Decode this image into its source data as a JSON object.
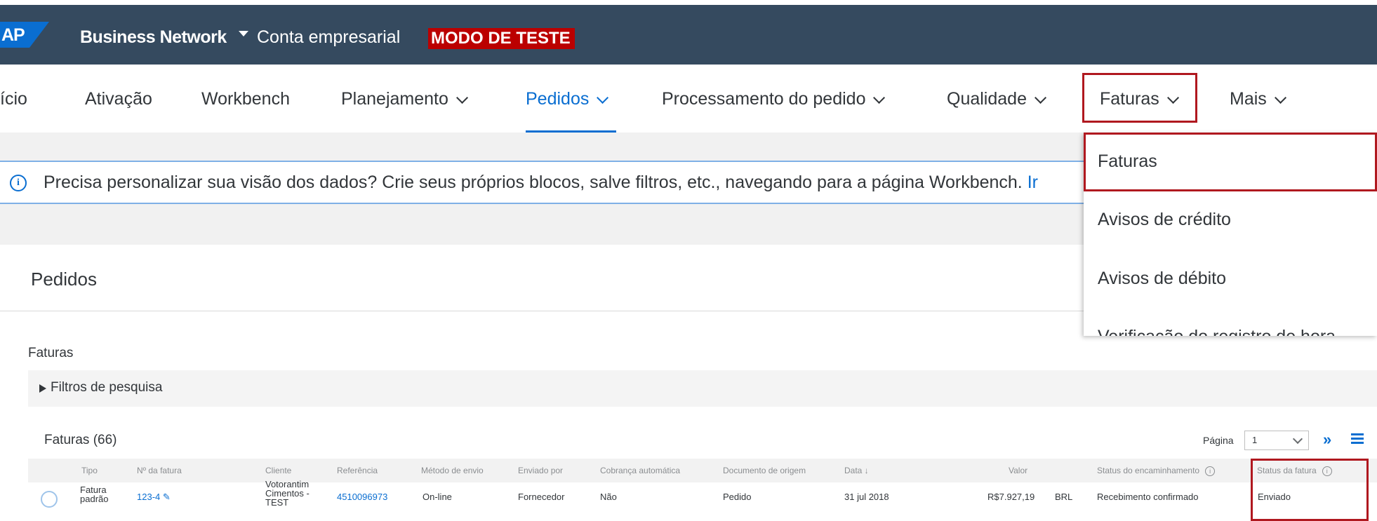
{
  "header": {
    "logo_text": "AP",
    "product": "Business Network",
    "account": "Conta empresarial",
    "test_mode": "MODO DE TESTE"
  },
  "nav": {
    "items": [
      {
        "label": "ício"
      },
      {
        "label": "Ativação"
      },
      {
        "label": "Workbench"
      },
      {
        "label": "Planejamento"
      },
      {
        "label": "Pedidos"
      },
      {
        "label": "Processamento do pedido"
      },
      {
        "label": "Qualidade"
      },
      {
        "label": "Faturas"
      },
      {
        "label": "Mais"
      }
    ],
    "active": "Pedidos"
  },
  "info": {
    "icon": "info-icon",
    "text": "Precisa personalizar sua visão dos dados? Crie seus próprios blocos, salve filtros, etc., navegando para a página Workbench.",
    "link": "Ir"
  },
  "section": {
    "title": "Pedidos"
  },
  "invoices": {
    "title": "Faturas",
    "filters_label": "Filtros de pesquisa",
    "table_title": "Faturas (66)",
    "page_label": "Página",
    "page_value": "1",
    "columns": [
      "Tipo",
      "Nº da fatura",
      "Cliente",
      "Referência",
      "Método de envio",
      "Enviado por",
      "Cobrança automática",
      "Documento de origem",
      "Data ↓",
      "Valor",
      "Status do encaminhamento",
      "Status da fatura"
    ],
    "rows": [
      {
        "tipo": "Fatura padrão",
        "numero": "123-4",
        "cliente": "Votorantim Cimentos - TEST",
        "referencia": "4510096973",
        "metodo": "On-line",
        "enviado_por": "Fornecedor",
        "cobranca": "Não",
        "documento": "Pedido",
        "data": "31 jul 2018",
        "valor": "R$7.927,19",
        "moeda": "BRL",
        "status_encaminhamento": "Recebimento confirmado",
        "status_fatura": "Enviado"
      }
    ]
  },
  "dropdown": {
    "items": [
      "Faturas",
      "Avisos de crédito",
      "Avisos de débito",
      "Verificação do registro de hora"
    ]
  }
}
